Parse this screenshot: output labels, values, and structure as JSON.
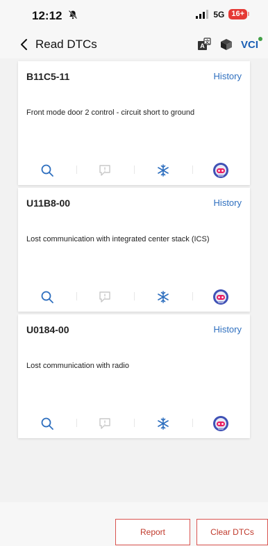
{
  "status_bar": {
    "time": "12:12",
    "network": "5G",
    "battery": "16+"
  },
  "header": {
    "title": "Read DTCs",
    "vci_label": "VCI"
  },
  "dtcs": [
    {
      "code": "B11C5-11",
      "history_label": "History",
      "description": "Front mode door 2 control - circuit short to ground"
    },
    {
      "code": "U11B8-00",
      "history_label": "History",
      "description": "Lost communication with integrated center stack (ICS)"
    },
    {
      "code": "U0184-00",
      "history_label": "History",
      "description": "Lost communication with radio"
    }
  ],
  "footer": {
    "report_label": "Report",
    "clear_label": "Clear DTCs"
  },
  "icons": {
    "search": "search-icon",
    "comment": "comment-alert-icon",
    "freeze_frame": "snowflake-icon",
    "ai_assistant": "robot-avatar-icon"
  },
  "colors": {
    "accent_blue": "#2e6fbf",
    "danger_red": "#d9534f",
    "battery_red": "#e53935"
  }
}
